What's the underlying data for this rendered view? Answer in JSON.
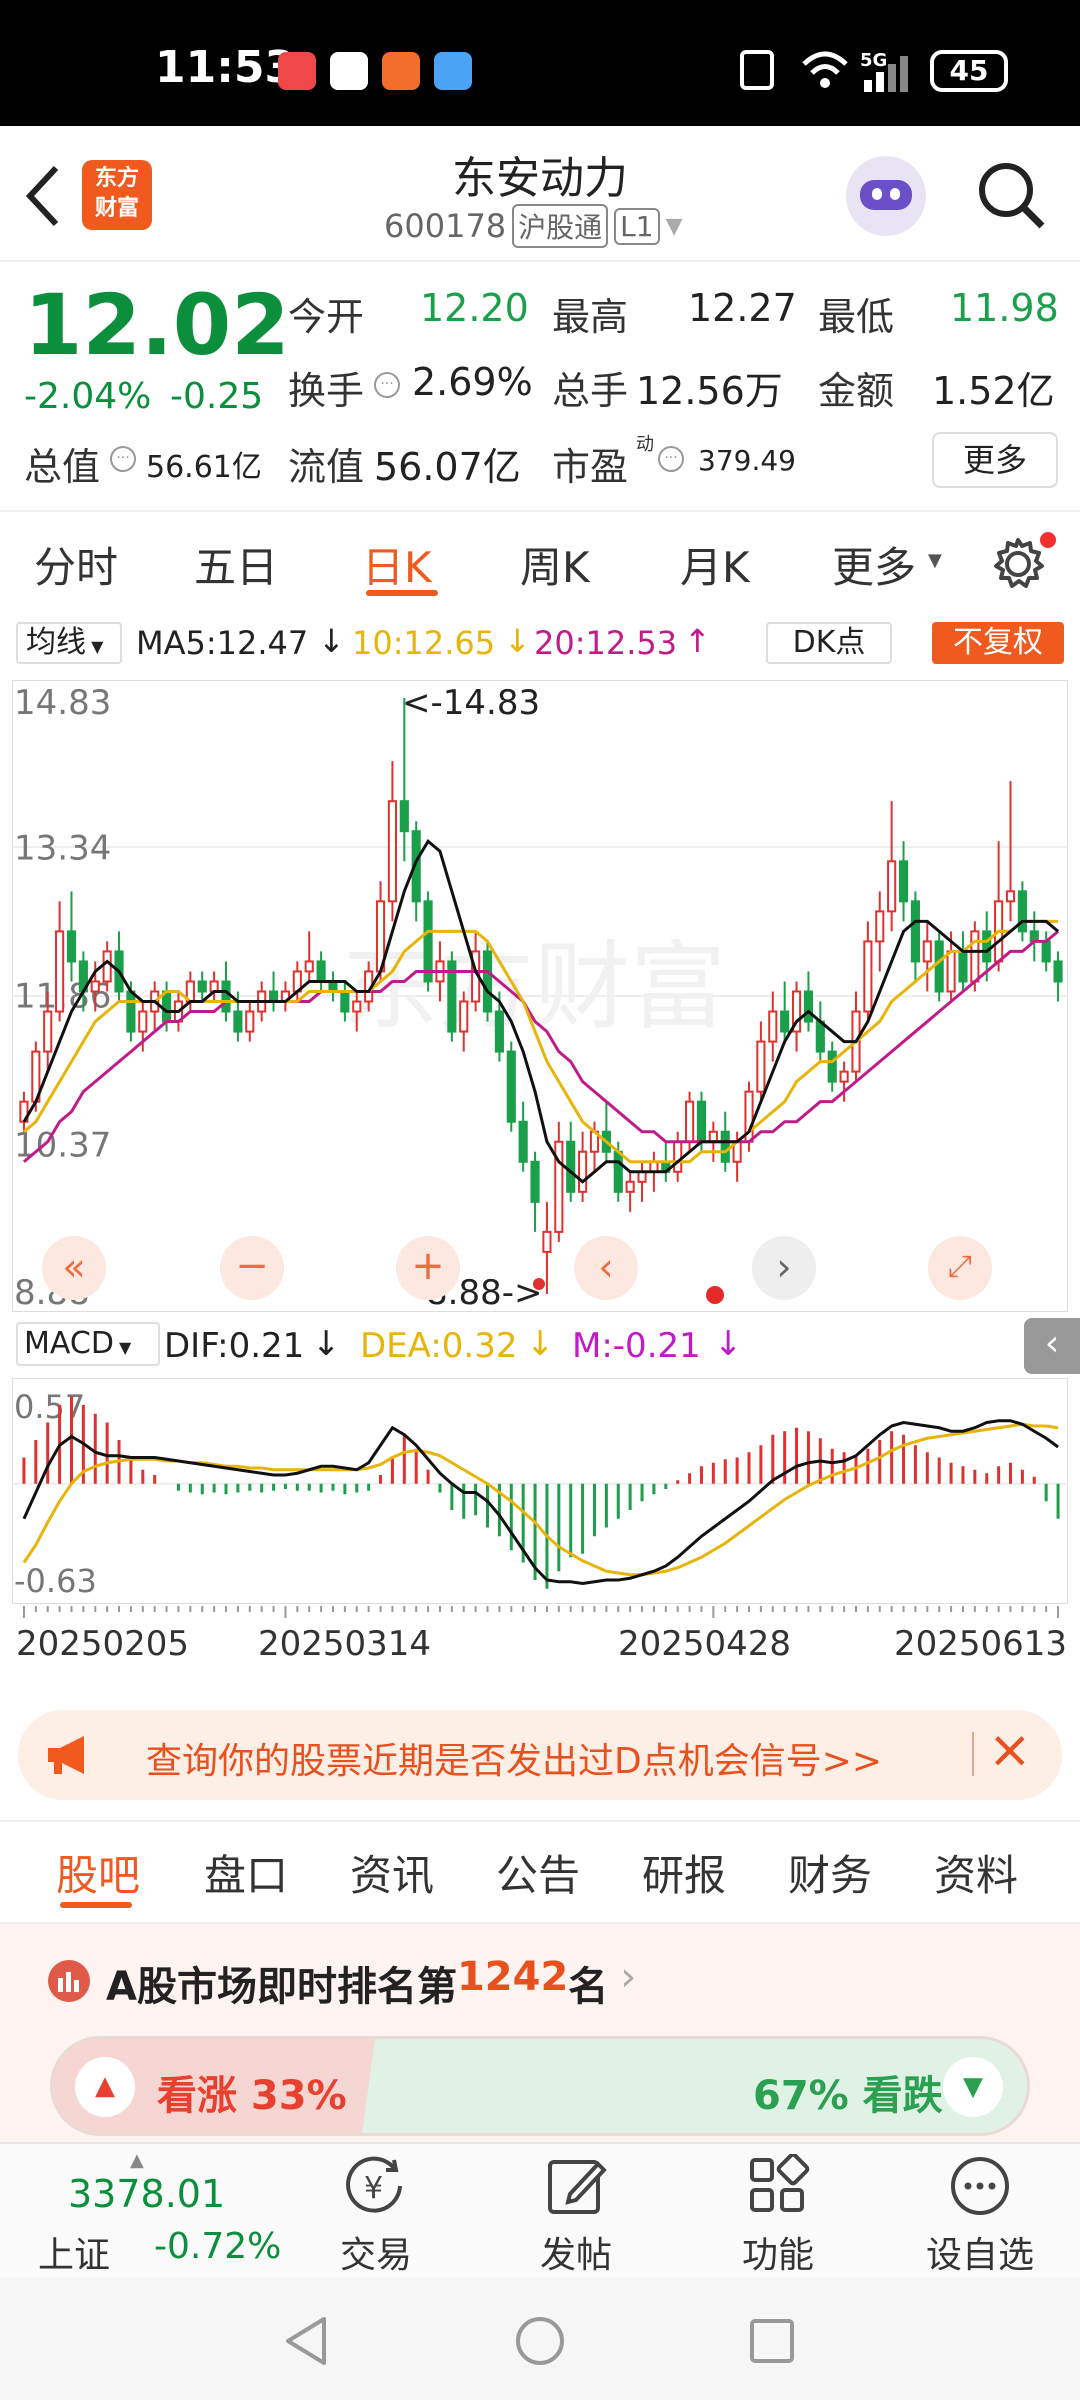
{
  "status": {
    "time": "11:53",
    "signal": "5G",
    "battery": "45"
  },
  "header": {
    "title": "东安动力",
    "code": "600178",
    "market": "沪股通",
    "level": "L1",
    "logo": "东方\n财富"
  },
  "quote": {
    "price": "12.02",
    "change_pct": "-2.04%",
    "change": "-0.25",
    "open_label": "今开",
    "open": "12.20",
    "high_label": "最高",
    "high": "12.27",
    "low_label": "最低",
    "low": "11.98",
    "turnover_label": "换手",
    "turnover": "2.69%",
    "volume_label": "总手",
    "volume": "12.56万",
    "amount_label": "金额",
    "amount": "1.52亿",
    "mktcap_label": "总值",
    "mktcap": "56.61亿",
    "float_label": "流值",
    "float": "56.07亿",
    "pe_label": "市盈",
    "pe_sup": "动",
    "pe": "379.49",
    "more_label": "更多"
  },
  "tabs": [
    "分时",
    "五日",
    "日K",
    "周K",
    "月K",
    "更多"
  ],
  "active_tab": "日K",
  "ma_bar": {
    "select": "均线",
    "ma5": "MA5:12.47",
    "ma10": "10:12.65",
    "ma20": "20:12.53",
    "dk": "DK点",
    "fq": "不复权"
  },
  "chart_data": {
    "type": "candlestick",
    "y_ticks": [
      "14.83",
      "13.34",
      "11.86",
      "10.37",
      "8.88"
    ],
    "ylim": [
      8.88,
      14.83
    ],
    "max_label": "<-14.83",
    "min_label": "8.88->",
    "x_ticks": [
      "20250205",
      "20250314",
      "20250428",
      "20250613"
    ],
    "watermark": "东方财富",
    "candles": [
      [
        10.6,
        10.9,
        10.5,
        10.8
      ],
      [
        10.8,
        11.4,
        10.7,
        11.3
      ],
      [
        11.3,
        11.9,
        11.1,
        11.7
      ],
      [
        11.7,
        12.8,
        11.6,
        12.5
      ],
      [
        12.5,
        12.9,
        12.0,
        12.2
      ],
      [
        12.2,
        12.3,
        11.7,
        11.9
      ],
      [
        11.9,
        12.2,
        11.7,
        12.0
      ],
      [
        12.0,
        12.4,
        11.9,
        12.3
      ],
      [
        12.3,
        12.5,
        11.8,
        11.9
      ],
      [
        11.9,
        12.0,
        11.4,
        11.5
      ],
      [
        11.5,
        11.8,
        11.3,
        11.7
      ],
      [
        11.7,
        12.0,
        11.5,
        11.9
      ],
      [
        11.9,
        12.0,
        11.5,
        11.6
      ],
      [
        11.6,
        11.9,
        11.5,
        11.8
      ],
      [
        11.8,
        12.1,
        11.7,
        12.0
      ],
      [
        12.0,
        12.1,
        11.8,
        11.9
      ],
      [
        11.9,
        12.1,
        11.8,
        12.0
      ],
      [
        12.0,
        12.2,
        11.6,
        11.7
      ],
      [
        11.7,
        11.9,
        11.4,
        11.5
      ],
      [
        11.5,
        11.8,
        11.4,
        11.7
      ],
      [
        11.7,
        12.0,
        11.6,
        11.9
      ],
      [
        11.9,
        12.1,
        11.7,
        11.8
      ],
      [
        11.8,
        12.0,
        11.7,
        11.9
      ],
      [
        11.9,
        12.2,
        11.8,
        12.1
      ],
      [
        12.1,
        12.5,
        12.0,
        12.2
      ],
      [
        12.2,
        12.3,
        11.9,
        12.0
      ],
      [
        12.0,
        12.1,
        11.8,
        11.9
      ],
      [
        11.9,
        12.0,
        11.6,
        11.7
      ],
      [
        11.7,
        11.9,
        11.5,
        11.8
      ],
      [
        11.8,
        12.2,
        11.7,
        12.1
      ],
      [
        12.1,
        13.0,
        12.0,
        12.8
      ],
      [
        12.8,
        14.2,
        12.6,
        13.8
      ],
      [
        13.8,
        14.83,
        13.2,
        13.5
      ],
      [
        13.5,
        13.6,
        12.6,
        12.8
      ],
      [
        12.8,
        12.9,
        11.9,
        12.0
      ],
      [
        12.0,
        12.4,
        11.8,
        12.2
      ],
      [
        12.2,
        12.3,
        11.4,
        11.5
      ],
      [
        11.5,
        11.9,
        11.3,
        11.8
      ],
      [
        11.8,
        12.5,
        11.7,
        12.3
      ],
      [
        12.3,
        12.4,
        11.6,
        11.7
      ],
      [
        11.7,
        11.9,
        11.2,
        11.3
      ],
      [
        11.3,
        11.4,
        10.5,
        10.6
      ],
      [
        10.6,
        10.8,
        10.1,
        10.2
      ],
      [
        10.2,
        10.3,
        9.5,
        9.8
      ],
      [
        9.3,
        9.8,
        8.88,
        9.5
      ],
      [
        9.5,
        10.6,
        9.4,
        10.4
      ],
      [
        10.4,
        10.6,
        9.8,
        9.9
      ],
      [
        9.9,
        10.5,
        9.8,
        10.3
      ],
      [
        10.3,
        10.6,
        10.1,
        10.5
      ],
      [
        10.5,
        10.8,
        10.2,
        10.3
      ],
      [
        10.3,
        10.4,
        9.8,
        9.9
      ],
      [
        9.9,
        10.1,
        9.7,
        10.0
      ],
      [
        10.0,
        10.2,
        9.8,
        10.1
      ],
      [
        10.1,
        10.3,
        9.9,
        10.2
      ],
      [
        10.2,
        10.4,
        10.0,
        10.1
      ],
      [
        10.1,
        10.5,
        10.0,
        10.4
      ],
      [
        10.4,
        10.9,
        10.3,
        10.8
      ],
      [
        10.8,
        10.9,
        10.3,
        10.4
      ],
      [
        10.4,
        10.6,
        10.2,
        10.5
      ],
      [
        10.5,
        10.7,
        10.1,
        10.2
      ],
      [
        10.2,
        10.5,
        10.0,
        10.4
      ],
      [
        10.4,
        11.0,
        10.3,
        10.9
      ],
      [
        10.9,
        11.6,
        10.8,
        11.4
      ],
      [
        11.4,
        11.9,
        11.2,
        11.7
      ],
      [
        11.7,
        12.0,
        11.4,
        11.5
      ],
      [
        11.5,
        12.0,
        11.3,
        11.9
      ],
      [
        11.9,
        12.1,
        11.5,
        11.6
      ],
      [
        11.6,
        11.8,
        11.2,
        11.3
      ],
      [
        11.3,
        11.4,
        10.9,
        11.0
      ],
      [
        11.0,
        11.2,
        10.8,
        11.1
      ],
      [
        11.1,
        11.9,
        11.0,
        11.7
      ],
      [
        11.7,
        12.6,
        11.6,
        12.4
      ],
      [
        12.4,
        12.9,
        12.1,
        12.7
      ],
      [
        12.7,
        13.8,
        12.5,
        13.2
      ],
      [
        13.2,
        13.4,
        12.6,
        12.8
      ],
      [
        12.8,
        12.9,
        12.0,
        12.2
      ],
      [
        12.2,
        12.6,
        11.9,
        12.4
      ],
      [
        12.4,
        12.5,
        11.8,
        11.9
      ],
      [
        11.9,
        12.5,
        11.8,
        12.3
      ],
      [
        12.3,
        12.5,
        11.9,
        12.0
      ],
      [
        12.0,
        12.6,
        11.9,
        12.5
      ],
      [
        12.5,
        12.7,
        12.0,
        12.2
      ],
      [
        12.2,
        13.4,
        12.1,
        12.8
      ],
      [
        12.8,
        14.0,
        12.6,
        12.9
      ],
      [
        12.9,
        13.0,
        12.4,
        12.5
      ],
      [
        12.5,
        12.7,
        12.2,
        12.4
      ],
      [
        12.4,
        12.5,
        12.1,
        12.2
      ],
      [
        12.2,
        12.3,
        11.8,
        12.0
      ]
    ],
    "ma5": [
      10.6,
      10.8,
      11.1,
      11.4,
      11.7,
      11.9,
      12.1,
      12.2,
      12.1,
      11.9,
      11.8,
      11.8,
      11.7,
      11.7,
      11.8,
      11.8,
      11.9,
      11.9,
      11.8,
      11.8,
      11.8,
      11.8,
      11.8,
      11.9,
      12.0,
      12.0,
      12.0,
      12.0,
      11.9,
      11.9,
      12.1,
      12.5,
      12.9,
      13.2,
      13.4,
      13.3,
      12.9,
      12.5,
      12.1,
      11.9,
      11.8,
      11.6,
      11.3,
      10.9,
      10.4,
      10.2,
      10.1,
      10.0,
      10.1,
      10.2,
      10.2,
      10.1,
      10.1,
      10.1,
      10.1,
      10.2,
      10.3,
      10.4,
      10.4,
      10.4,
      10.4,
      10.5,
      10.8,
      11.1,
      11.4,
      11.6,
      11.7,
      11.6,
      11.5,
      11.4,
      11.4,
      11.6,
      11.9,
      12.2,
      12.5,
      12.6,
      12.6,
      12.5,
      12.4,
      12.3,
      12.3,
      12.3,
      12.4,
      12.5,
      12.6,
      12.6,
      12.6,
      12.5
    ],
    "ma10": [
      10.5,
      10.6,
      10.8,
      11.0,
      11.2,
      11.4,
      11.6,
      11.7,
      11.8,
      11.8,
      11.8,
      11.8,
      11.9,
      11.9,
      11.8,
      11.8,
      11.8,
      11.8,
      11.8,
      11.8,
      11.8,
      11.8,
      11.8,
      11.8,
      11.9,
      11.9,
      11.9,
      11.9,
      11.9,
      11.9,
      12.0,
      12.1,
      12.3,
      12.4,
      12.5,
      12.5,
      12.5,
      12.5,
      12.5,
      12.4,
      12.2,
      12.0,
      11.8,
      11.5,
      11.2,
      11.0,
      10.8,
      10.6,
      10.5,
      10.4,
      10.3,
      10.2,
      10.2,
      10.2,
      10.2,
      10.2,
      10.2,
      10.3,
      10.3,
      10.3,
      10.4,
      10.5,
      10.6,
      10.7,
      10.8,
      11.0,
      11.1,
      11.2,
      11.2,
      11.3,
      11.4,
      11.5,
      11.6,
      11.8,
      11.9,
      12.0,
      12.1,
      12.2,
      12.3,
      12.3,
      12.4,
      12.4,
      12.5,
      12.5,
      12.6,
      12.6,
      12.6,
      12.6
    ],
    "ma20": [
      10.2,
      10.3,
      10.4,
      10.6,
      10.7,
      10.9,
      11.0,
      11.1,
      11.2,
      11.3,
      11.4,
      11.5,
      11.6,
      11.6,
      11.7,
      11.7,
      11.7,
      11.8,
      11.8,
      11.8,
      11.8,
      11.8,
      11.8,
      11.8,
      11.8,
      11.9,
      11.9,
      11.9,
      11.9,
      11.9,
      11.9,
      12.0,
      12.0,
      12.1,
      12.1,
      12.1,
      12.1,
      12.1,
      12.1,
      12.1,
      12.0,
      11.9,
      11.8,
      11.6,
      11.5,
      11.3,
      11.2,
      11.0,
      10.9,
      10.8,
      10.7,
      10.6,
      10.5,
      10.5,
      10.4,
      10.4,
      10.4,
      10.4,
      10.4,
      10.4,
      10.4,
      10.4,
      10.5,
      10.5,
      10.6,
      10.6,
      10.7,
      10.8,
      10.8,
      10.9,
      11.0,
      11.1,
      11.2,
      11.3,
      11.4,
      11.5,
      11.6,
      11.7,
      11.8,
      11.9,
      12.0,
      12.1,
      12.2,
      12.3,
      12.3,
      12.4,
      12.4,
      12.5
    ],
    "macd": {
      "dif_label": "DIF:0.21",
      "dea_label": "DEA:0.32",
      "m_label": "M:-0.21",
      "select": "MACD",
      "y_ticks": [
        "0.57",
        "-0.63"
      ],
      "ylim": [
        -0.63,
        0.57
      ],
      "hist": [
        0.15,
        0.25,
        0.35,
        0.45,
        0.5,
        0.45,
        0.4,
        0.35,
        0.25,
        0.15,
        0.08,
        0.05,
        0.0,
        -0.04,
        -0.05,
        -0.06,
        -0.05,
        -0.06,
        -0.05,
        -0.04,
        -0.05,
        -0.04,
        -0.03,
        -0.04,
        -0.04,
        -0.05,
        -0.04,
        -0.06,
        -0.05,
        -0.04,
        0.05,
        0.15,
        0.28,
        0.2,
        0.08,
        -0.05,
        -0.15,
        -0.2,
        -0.18,
        -0.25,
        -0.3,
        -0.38,
        -0.45,
        -0.55,
        -0.6,
        -0.5,
        -0.42,
        -0.4,
        -0.3,
        -0.25,
        -0.2,
        -0.15,
        -0.1,
        -0.06,
        -0.03,
        0.02,
        0.06,
        0.1,
        0.12,
        0.14,
        0.15,
        0.18,
        0.22,
        0.28,
        0.3,
        0.32,
        0.3,
        0.26,
        0.2,
        0.18,
        0.16,
        0.2,
        0.25,
        0.3,
        0.28,
        0.22,
        0.18,
        0.15,
        0.12,
        0.1,
        0.08,
        0.06,
        0.1,
        0.12,
        0.08,
        0.04,
        -0.1,
        -0.2
      ],
      "dif": [
        -0.2,
        -0.05,
        0.1,
        0.22,
        0.27,
        0.23,
        0.18,
        0.16,
        0.16,
        0.15,
        0.15,
        0.15,
        0.14,
        0.13,
        0.12,
        0.11,
        0.1,
        0.09,
        0.08,
        0.07,
        0.06,
        0.05,
        0.05,
        0.06,
        0.08,
        0.1,
        0.1,
        0.09,
        0.08,
        0.12,
        0.22,
        0.32,
        0.28,
        0.22,
        0.14,
        0.06,
        0.0,
        -0.05,
        -0.05,
        -0.1,
        -0.18,
        -0.28,
        -0.38,
        -0.48,
        -0.55,
        -0.56,
        -0.56,
        -0.57,
        -0.56,
        -0.55,
        -0.55,
        -0.54,
        -0.52,
        -0.5,
        -0.47,
        -0.42,
        -0.36,
        -0.3,
        -0.25,
        -0.2,
        -0.15,
        -0.1,
        -0.04,
        0.02,
        0.06,
        0.1,
        0.12,
        0.13,
        0.12,
        0.13,
        0.16,
        0.22,
        0.28,
        0.33,
        0.35,
        0.34,
        0.33,
        0.32,
        0.3,
        0.3,
        0.32,
        0.35,
        0.36,
        0.36,
        0.34,
        0.3,
        0.26,
        0.21
      ],
      "dea": [
        -0.45,
        -0.35,
        -0.22,
        -0.1,
        0.0,
        0.07,
        0.1,
        0.12,
        0.13,
        0.14,
        0.14,
        0.14,
        0.13,
        0.13,
        0.12,
        0.12,
        0.11,
        0.1,
        0.1,
        0.09,
        0.09,
        0.08,
        0.08,
        0.08,
        0.08,
        0.08,
        0.08,
        0.08,
        0.08,
        0.09,
        0.11,
        0.15,
        0.18,
        0.19,
        0.18,
        0.16,
        0.12,
        0.08,
        0.04,
        0.0,
        -0.05,
        -0.1,
        -0.16,
        -0.22,
        -0.3,
        -0.36,
        -0.4,
        -0.44,
        -0.47,
        -0.5,
        -0.51,
        -0.52,
        -0.52,
        -0.51,
        -0.5,
        -0.48,
        -0.45,
        -0.42,
        -0.38,
        -0.34,
        -0.29,
        -0.24,
        -0.19,
        -0.14,
        -0.09,
        -0.05,
        -0.01,
        0.02,
        0.05,
        0.07,
        0.09,
        0.12,
        0.15,
        0.19,
        0.22,
        0.24,
        0.26,
        0.27,
        0.28,
        0.29,
        0.3,
        0.31,
        0.32,
        0.33,
        0.34,
        0.33,
        0.33,
        0.32
      ]
    }
  },
  "promo": {
    "text": "查询你的股票近期是否发出过D点机会信号>>"
  },
  "subtabs": [
    "股吧",
    "盘口",
    "资讯",
    "公告",
    "研报",
    "财务",
    "资料"
  ],
  "active_subtab": "股吧",
  "rank": {
    "prefix": "A股市场即时排名第",
    "number": "1242",
    "suffix": "名"
  },
  "sentiment": {
    "up_label": "看涨 33%",
    "down_label": "67% 看跌",
    "up_pct": 33
  },
  "index": {
    "value": "3378.01",
    "name": "上证",
    "change": "-0.72%"
  },
  "bottom_nav": [
    "交易",
    "发帖",
    "功能",
    "设自选"
  ],
  "colors": {
    "up": "#e0312e",
    "down": "#1aa04a",
    "ma5": "#111111",
    "ma10": "#e8b40a",
    "ma20": "#c01b8a",
    "accent": "#ff5a1f"
  }
}
